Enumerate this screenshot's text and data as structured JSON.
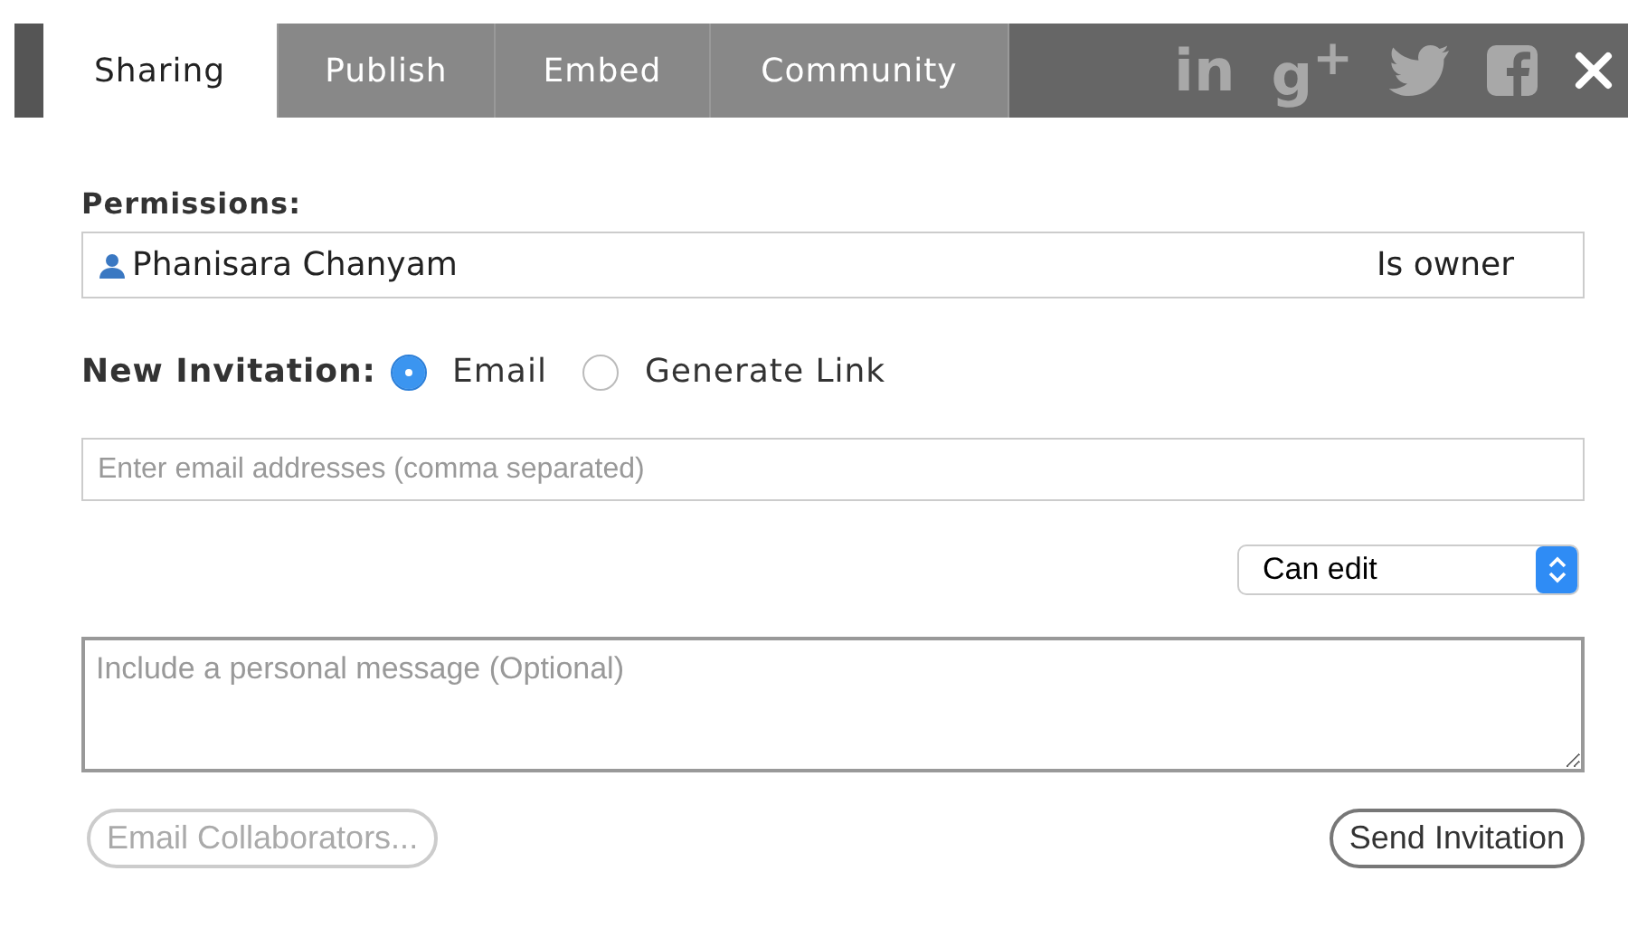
{
  "tabs": [
    {
      "label": "Sharing",
      "selected": true
    },
    {
      "label": "Publish",
      "selected": false
    },
    {
      "label": "Embed",
      "selected": false
    },
    {
      "label": "Community",
      "selected": false
    }
  ],
  "social": [
    {
      "kind": "text",
      "label": "in"
    },
    {
      "kind": "text",
      "label": "g$^{+}$"
    },
    {
      "kind": "twitter"
    },
    {
      "kind": "facebook"
    },
    {
      "kind": "close"
    }
  ],
  "permissions": {
    "label": "Permissions:",
    "user": "Phanisara Chanyam",
    "role": "Is owner"
  },
  "invitation": {
    "label": "New Invitation:",
    "options": [
      {
        "label": "Email",
        "selected": true
      },
      {
        "label": "Generate Link",
        "selected": false
      }
    ]
  },
  "email_field": {
    "placeholder": "Enter email addresses (comma separated)"
  },
  "access": {
    "value": "Can edit"
  },
  "message": {
    "placeholder": "Include a personal message (Optional)"
  },
  "buttons": [
    {
      "label": "Email Collaborators...",
      "disabled": true
    },
    {
      "label": "Send Invitation",
      "disabled": false
    }
  ]
}
